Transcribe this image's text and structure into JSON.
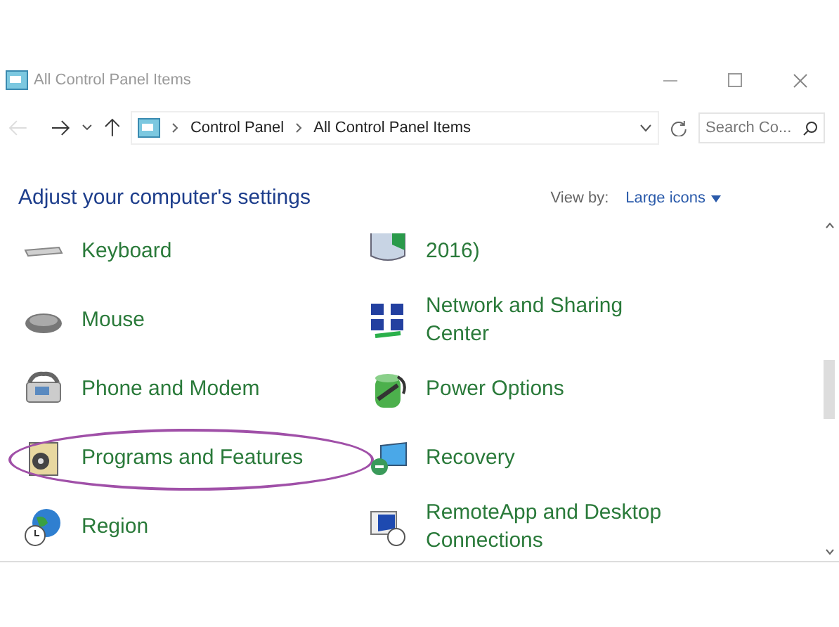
{
  "window": {
    "title": "All Control Panel Items"
  },
  "address_bar": {
    "path": [
      "Control Panel",
      "All Control Panel Items"
    ]
  },
  "search": {
    "placeholder": "Search Co..."
  },
  "heading": "Adjust your computer's settings",
  "view_by": {
    "label": "View by:",
    "value": "Large icons"
  },
  "columns": [
    [
      {
        "label": "Keyboard",
        "highlighted": false
      },
      {
        "label": "Mouse",
        "highlighted": false
      },
      {
        "label": "Phone and Modem",
        "highlighted": false
      },
      {
        "label": "Programs and Features",
        "highlighted": true
      },
      {
        "label": "Region",
        "highlighted": false
      }
    ],
    [
      {
        "label": "2016)",
        "highlighted": false
      },
      {
        "label": "Network and Sharing Center",
        "highlighted": false
      },
      {
        "label": "Power Options",
        "highlighted": false
      },
      {
        "label": "Recovery",
        "highlighted": false
      },
      {
        "label": "RemoteApp and Desktop Connections",
        "highlighted": false
      }
    ]
  ]
}
